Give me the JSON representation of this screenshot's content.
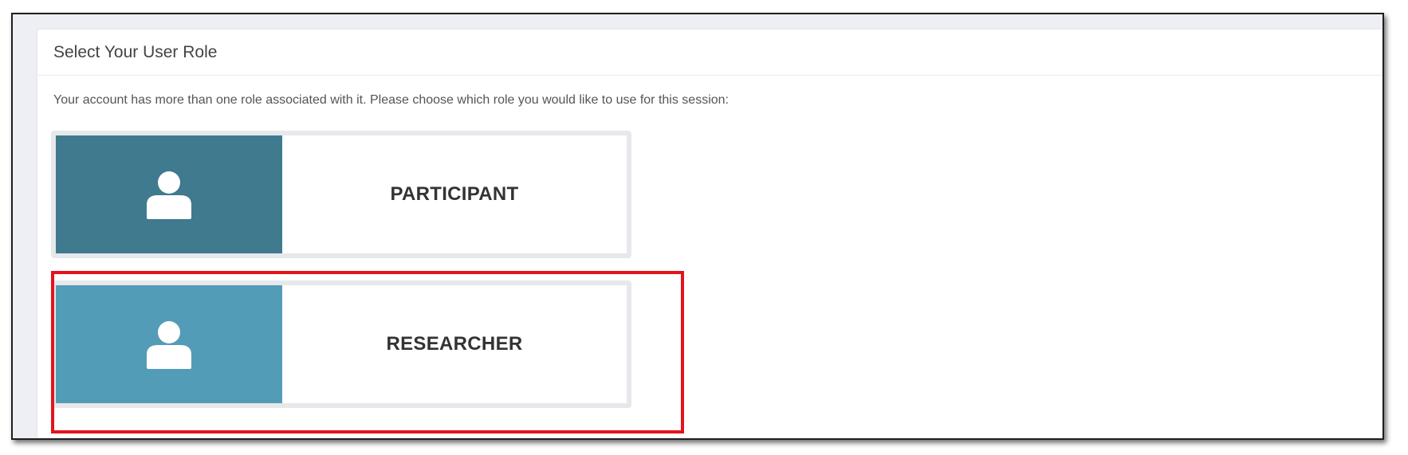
{
  "panel": {
    "title": "Select Your User Role",
    "description": "Your account has more than one role associated with it. Please choose which role you would like to use for this session:"
  },
  "roles": [
    {
      "label": "PARTICIPANT",
      "icon": "user-icon",
      "color": "#3f7a8f"
    },
    {
      "label": "RESEARCHER",
      "icon": "user-icon",
      "color": "#539cb8"
    }
  ],
  "highlight": {
    "target": "RESEARCHER",
    "color": "#e3141c"
  }
}
